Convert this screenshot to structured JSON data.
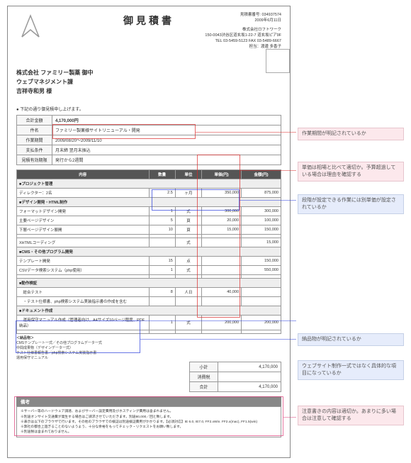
{
  "doc": {
    "title": "御見積書",
    "quote_no_label": "見積書番号: 034937574",
    "date": "2009年6月11日",
    "company": "株式会社ロフトワーク",
    "addr1": "150-0043渋谷区道玄坂1-22-7 道玄坂ピア9F",
    "addr2": "TEL 03-5459-5123 FAX 03-5489-6667",
    "contact_label": "担当：",
    "contact": "渡邊 多香子",
    "client": {
      "company": "株式会社 ファミリー製薬 御中",
      "dept": "ウェブマネジメント課",
      "person": "吉祥寺和男 様"
    },
    "lead": "● 下記の通り御見積申し上げます。",
    "summary": {
      "total_label": "合計金額",
      "total": "4,170,000円",
      "name_label": "件名",
      "name": "ファミリー製薬様サイトリニューアル・開発",
      "period_label": "作業期間",
      "period": "2009/08/20〜2009/11/10",
      "pay_label": "支払条件",
      "pay": "月末締 翌月末振込",
      "valid_label": "見積有効期限",
      "valid": "発行から2週間"
    },
    "hdr": {
      "desc": "内容",
      "qty": "数量",
      "unit": "単位",
      "price": "単価(円)",
      "amt": "金額(円)"
    },
    "sections": [
      {
        "title": "■プロジェクト管理",
        "rows": [
          {
            "desc": "ディレクター：2名",
            "qty": "2.5",
            "unit": "ヶ月",
            "price": "350,000",
            "amt": "875,000"
          }
        ]
      },
      {
        "title": "■デザイン開発・HTML制作",
        "rows": [
          {
            "desc": "フォーマットデザイン開発",
            "qty": "1",
            "unit": "式",
            "price": "300,000",
            "amt": "300,000"
          },
          {
            "desc": "主要ページデザイン",
            "qty": "5",
            "unit": "頁",
            "price": "20,000",
            "amt": "100,000"
          },
          {
            "desc": "下層ページデザイン展開",
            "qty": "10",
            "unit": "頁",
            "price": "15,000",
            "amt": "150,000"
          },
          {
            "desc": "",
            "qty": "",
            "unit": "",
            "price": "",
            "amt": ""
          },
          {
            "desc": "XHTMLコーディング",
            "qty": "",
            "unit": "式",
            "price": "",
            "amt": "15,000"
          }
        ]
      },
      {
        "title": "■CMS・その他プログラム開発",
        "rows": [
          {
            "desc": "テンプレート開発",
            "qty": "15",
            "unit": "点",
            "price": "",
            "amt": "150,000"
          },
          {
            "desc": "CSVデータ検索システム（php使用）",
            "qty": "1",
            "unit": "式",
            "price": "",
            "amt": "550,000"
          },
          {
            "desc": "",
            "qty": "",
            "unit": "",
            "price": "",
            "amt": ""
          }
        ]
      },
      {
        "title": "■動作検証",
        "rows": [
          {
            "desc": "　総合テスト",
            "qty": "8",
            "unit": "人日",
            "price": "40,000",
            "amt": ""
          },
          {
            "desc": "　・テスト仕様書、php検索システム実装指示書の作成を含む",
            "qty": "",
            "unit": "",
            "price": "",
            "amt": ""
          }
        ]
      },
      {
        "title": "■ドキュメント作成",
        "rows": [
          {
            "desc": "　運用保守マニュアル作成（管理者向け、A4サイズ10ページ程度、PDF納品）",
            "qty": "1",
            "unit": "式",
            "price": "200,000",
            "amt": "200,000"
          },
          {
            "desc": "",
            "qty": "",
            "unit": "",
            "price": "",
            "amt": ""
          }
        ]
      }
    ],
    "deliv": {
      "title": "＜納品物＞",
      "items": [
        "CMSテンプレート一式／その他プログラムデータ一式",
        "中間成果物（デザインデータ一式）",
        "テスト仕様書報告書／php検索システム実装指示書",
        "運用保守マニュアル"
      ]
    },
    "totals": {
      "subtotal_label": "小計",
      "subtotal": "4,170,000",
      "tax_label": "消費税",
      "tax": "",
      "total_label": "合計",
      "total": "4,170,000"
    },
    "notes": {
      "title": "備考",
      "body": [
        "※サーバー等のハードウェア調達、およびサーバー設定費用及びホスティング費用は含まれません。",
        "※別途オンサイト交通費が発生する場合はご請求させていただきます。別途80,000／回と致します。",
        "※表示は以下のブラウザで行います。その他のブラウザでの検証は別途検証費用がかかります。【必須対応】IE 6.0, IE7.0, FF2.xWin. FF2.x(mac), FF1.5(win)",
        "※弊社の都合上過ぎることのないようよう、十分な余裕をもってチェック・リクエストをお願い致します。",
        "※別途税は含まれておりません。"
      ]
    }
  },
  "comments": {
    "c1": "作業期間が明記されているか",
    "c2": "単価は相場と比べて適切か。予算超過している場合は理由を確認する",
    "c3": "段階が設定できる作業には別単価が設定されているか",
    "c4": "納品物が明記されているか",
    "c5": "ウェブサイト制作一式ではなく具体的な項目になっているか",
    "c6": "注意書きの内容は適切か。あまりに多い場合は注意して確認する"
  }
}
